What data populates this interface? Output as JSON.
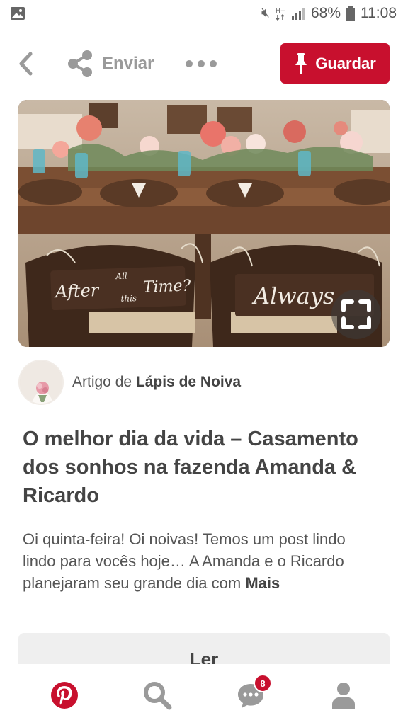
{
  "status_bar": {
    "battery": "68%",
    "time": "11:08",
    "icons": [
      "image-icon",
      "mute-icon",
      "data-icon",
      "signal-icon",
      "battery-icon"
    ]
  },
  "top_bar": {
    "share_label": "Enviar",
    "save_label": "Guardar",
    "icons": [
      "back-icon",
      "share-icon",
      "more-icon",
      "pin-icon"
    ],
    "accent_color": "#c8102e"
  },
  "image": {
    "sign_left": {
      "word1": "After",
      "word2": "All",
      "word3": "this",
      "word4": "Time?"
    },
    "sign_right": {
      "word1": "Always"
    },
    "expand_icon": "expand-icon"
  },
  "attribution": {
    "prefix": "Artigo de",
    "source": "Lápis de Noiva"
  },
  "pin": {
    "title": "O melhor dia da vida – Casamento dos sonhos na fazenda Amanda & Ricardo",
    "description": "Oi quinta-feira! Oi noivas! Temos um post lindo lindo para vocês hoje… A Amanda e o Ricardo planejaram seu grande dia com",
    "more_label": "Mais"
  },
  "read_button": {
    "label": "Ler"
  },
  "bottom_nav": {
    "items": [
      "home-icon",
      "search-icon",
      "messages-icon",
      "profile-icon"
    ],
    "messages_badge": "8"
  }
}
